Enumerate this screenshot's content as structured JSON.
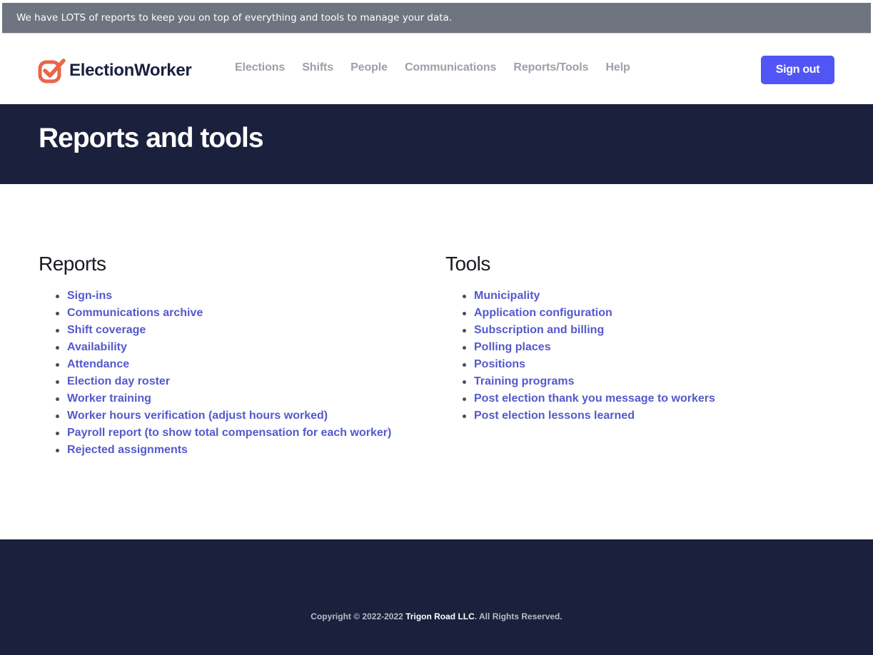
{
  "banner": {
    "text": "We have LOTS of reports to keep you on top of everything and tools to manage your data."
  },
  "header": {
    "logo_text": "ElectionWorker",
    "logo_icon": "checkbox-check-icon",
    "brand_color": "#e8674a",
    "nav": [
      {
        "label": "Elections"
      },
      {
        "label": "Shifts"
      },
      {
        "label": "People"
      },
      {
        "label": "Communications"
      },
      {
        "label": "Reports/Tools"
      },
      {
        "label": "Help"
      }
    ],
    "signout_label": "Sign out",
    "accent_color": "#5255f5"
  },
  "hero": {
    "title": "Reports and tools"
  },
  "reports": {
    "heading": "Reports",
    "items": [
      "Sign-ins",
      "Communications archive",
      "Shift coverage",
      "Availability",
      "Attendance",
      "Election day roster",
      "Worker training",
      "Worker hours verification (adjust hours worked)",
      "Payroll report (to show total compensation for each worker)",
      "Rejected assignments"
    ]
  },
  "tools": {
    "heading": "Tools",
    "items": [
      "Municipality",
      "Application configuration",
      "Subscription and billing",
      "Polling places",
      "Positions",
      "Training programs",
      "Post election thank you message to workers",
      "Post election lessons learned"
    ]
  },
  "footer": {
    "prefix": "Copyright © 2022-2022 ",
    "company": "Trigon Road LLC",
    "suffix": ". All Rights Reserved."
  }
}
